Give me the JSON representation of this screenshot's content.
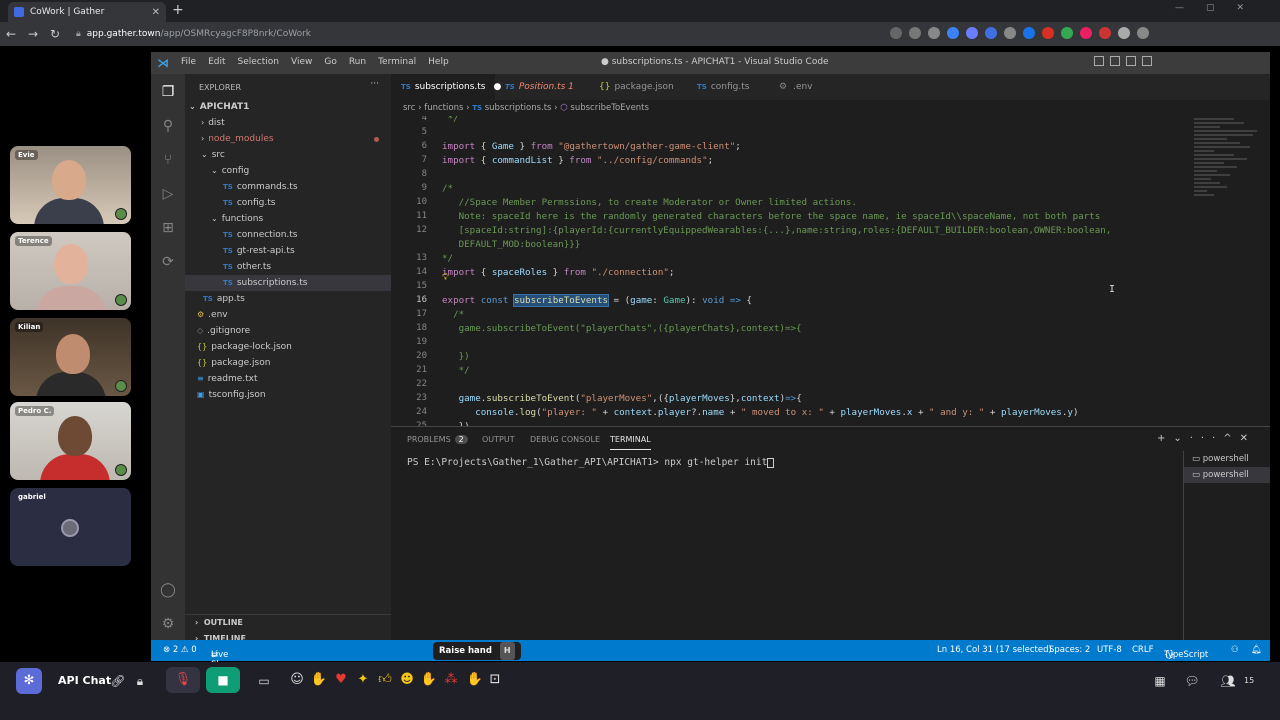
{
  "browser": {
    "tab_title": "CoWork | Gather",
    "url_host": "app.gather.town",
    "url_path": "/app/OSMRcyagcF8P8nrk/CoWork"
  },
  "participants": [
    {
      "name": "Evie"
    },
    {
      "name": "Terence"
    },
    {
      "name": "Kilian"
    },
    {
      "name": "Pedro C."
    },
    {
      "name": "gabriel"
    }
  ],
  "vscode": {
    "menu": [
      "File",
      "Edit",
      "Selection",
      "View",
      "Go",
      "Run",
      "Terminal",
      "Help"
    ],
    "window_title": "● subscriptions.ts - APICHAT1 - Visual Studio Code",
    "explorer_header": "EXPLORER",
    "root": "APICHAT1",
    "tree": [
      {
        "label": "dist",
        "kind": "folder"
      },
      {
        "label": "node_modules",
        "kind": "folder"
      },
      {
        "label": "src",
        "kind": "folder-open"
      },
      {
        "label": "config",
        "kind": "folder-open"
      },
      {
        "label": "commands.ts",
        "kind": "ts"
      },
      {
        "label": "config.ts",
        "kind": "ts"
      },
      {
        "label": "functions",
        "kind": "folder-open"
      },
      {
        "label": "connection.ts",
        "kind": "ts"
      },
      {
        "label": "gt-rest-api.ts",
        "kind": "ts"
      },
      {
        "label": "other.ts",
        "kind": "ts"
      },
      {
        "label": "subscriptions.ts",
        "kind": "ts"
      },
      {
        "label": "app.ts",
        "kind": "ts"
      },
      {
        "label": ".env",
        "kind": "file"
      },
      {
        "label": ".gitignore",
        "kind": "file"
      },
      {
        "label": "package-lock.json",
        "kind": "json"
      },
      {
        "label": "package.json",
        "kind": "json"
      },
      {
        "label": "readme.txt",
        "kind": "file"
      },
      {
        "label": "tsconfig.json",
        "kind": "json"
      }
    ],
    "tabs": [
      "subscriptions.ts",
      "Position.ts 1",
      "package.json",
      "config.ts",
      ".env"
    ],
    "breadcrumb": [
      "src",
      "functions",
      "subscriptions.ts",
      "subscribeToEvents"
    ],
    "outline": "OUTLINE",
    "timeline": "TIMELINE",
    "panel_tabs": {
      "problems": "PROBLEMS",
      "problems_count": "2",
      "output": "OUTPUT",
      "debug": "DEBUG CONSOLE",
      "terminal": "TERMINAL"
    },
    "terminal_line": "PS E:\\Projects\\Gather_1\\Gather_API\\APICHAT1> npx gt-helper init",
    "terminals": [
      "powershell",
      "powershell"
    ],
    "status": {
      "errors": "⊗ 2 ⚠ 0",
      "liveshare": "Live Share",
      "position": "Ln 16, Col 31 (17 selected)",
      "spaces": "Spaces: 2",
      "encoding": "UTF-8",
      "eol": "CRLF",
      "language": "TypeScript"
    }
  },
  "tooltip": {
    "label": "Raise hand",
    "key": "H"
  },
  "gather": {
    "space_name": "API Chat",
    "online_count": "15"
  },
  "colors": {
    "vscode_blue": "#007acc",
    "gather_purple": "#5b6bd8",
    "camera_green": "#0f9d76"
  }
}
